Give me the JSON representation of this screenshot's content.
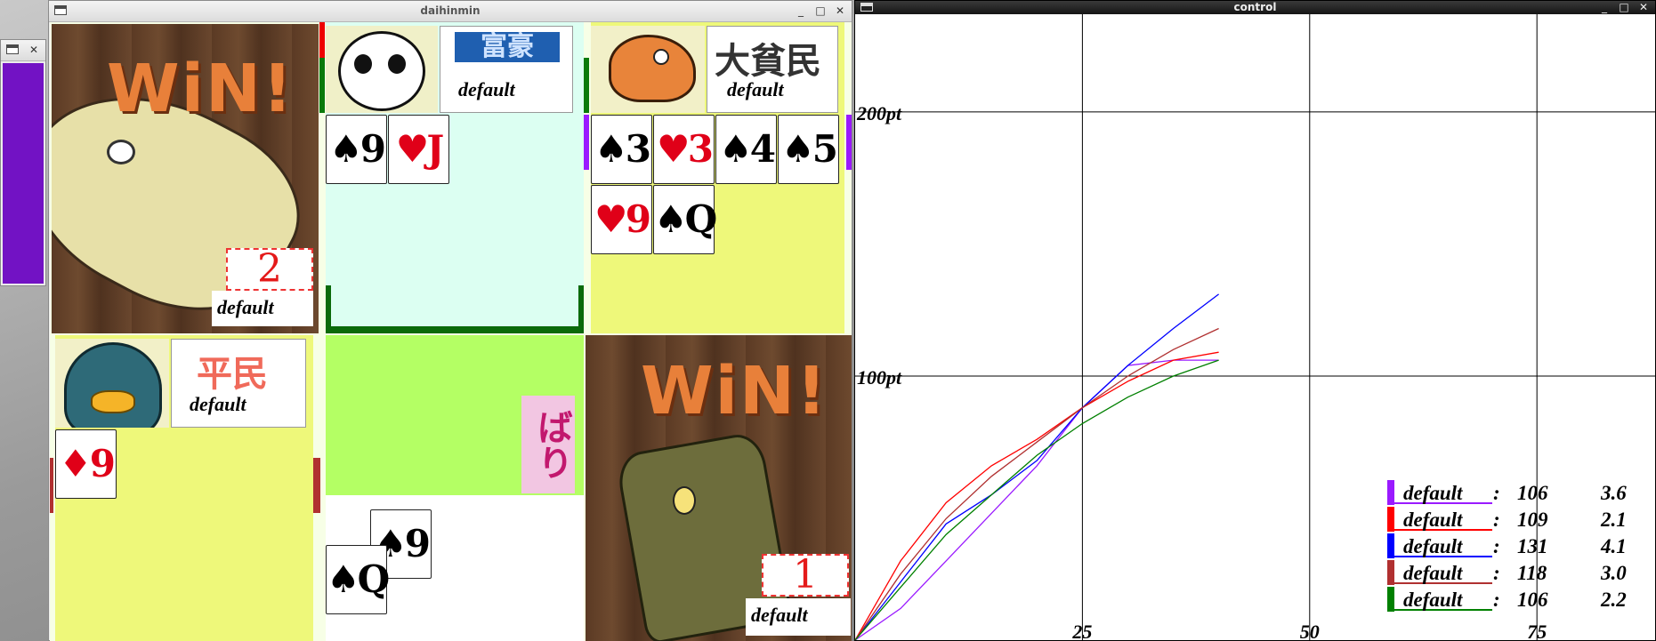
{
  "small_window": {
    "close": "✕"
  },
  "game_window": {
    "title": "daihinmin",
    "buttons": {
      "minimize": "_",
      "maximize": "□",
      "close": "✕"
    },
    "top_left": {
      "win_text": "WiN!",
      "rank_number": "2",
      "player_name": "default"
    },
    "top_middle": {
      "rank_label": "富豪",
      "player_name": "default",
      "cards": [
        {
          "suit": "♠",
          "rank": "9",
          "color": "black"
        },
        {
          "suit": "♥",
          "rank": "J",
          "color": "red"
        }
      ]
    },
    "top_right": {
      "rank_label": "大貧民",
      "player_name": "default",
      "cards": [
        {
          "suit": "♠",
          "rank": "3",
          "color": "black"
        },
        {
          "suit": "♥",
          "rank": "3",
          "color": "red"
        },
        {
          "suit": "♠",
          "rank": "4",
          "color": "black"
        },
        {
          "suit": "♠",
          "rank": "5",
          "color": "black"
        },
        {
          "suit": "♥",
          "rank": "9",
          "color": "red"
        },
        {
          "suit": "♠",
          "rank": "Q",
          "color": "black"
        }
      ]
    },
    "bottom_left": {
      "rank_label": "平民",
      "player_name": "default",
      "cards": [
        {
          "suit": "♦",
          "rank": "9",
          "color": "red"
        }
      ]
    },
    "center": {
      "status_stamp": "ばり",
      "played_cards": [
        {
          "suit": "♠",
          "rank": "9",
          "color": "black"
        },
        {
          "suit": "♠",
          "rank": "Q",
          "color": "black"
        }
      ]
    },
    "bottom_right": {
      "win_text": "WiN!",
      "rank_number": "1",
      "player_name": "default"
    }
  },
  "control_window": {
    "title": "control",
    "buttons": {
      "minimize": "_",
      "maximize": "□",
      "close": "✕"
    }
  },
  "chart_data": {
    "type": "line",
    "title": "",
    "xlabel": "",
    "ylabel": "",
    "x_ticks": [
      "25",
      "50",
      "75"
    ],
    "y_ticks": [
      "100pt",
      "200pt"
    ],
    "xlim": [
      0,
      88
    ],
    "ylim": [
      0,
      237
    ],
    "grid": true,
    "legend_position": "bottom-right",
    "series": [
      {
        "name": "default",
        "color": "#9a1aff",
        "score": "106",
        "avg": "3.6",
        "x": [
          0,
          5,
          10,
          15,
          20,
          25,
          30,
          35,
          40
        ],
        "y": [
          0,
          12,
          30,
          48,
          66,
          88,
          104,
          106,
          106
        ]
      },
      {
        "name": "default",
        "color": "#ff0000",
        "score": "109",
        "avg": "2.1",
        "x": [
          0,
          5,
          10,
          15,
          20,
          25,
          30,
          35,
          40
        ],
        "y": [
          0,
          30,
          52,
          66,
          76,
          88,
          98,
          106,
          109
        ]
      },
      {
        "name": "default",
        "color": "#0000ff",
        "score": "131",
        "avg": "4.1",
        "x": [
          0,
          5,
          10,
          15,
          20,
          25,
          30,
          35,
          40
        ],
        "y": [
          0,
          22,
          44,
          55,
          68,
          88,
          104,
          118,
          131
        ]
      },
      {
        "name": "default",
        "color": "#b03030",
        "score": "118",
        "avg": "3.0",
        "x": [
          0,
          5,
          10,
          15,
          20,
          25,
          30,
          35,
          40
        ],
        "y": [
          0,
          25,
          46,
          62,
          75,
          88,
          100,
          110,
          118
        ]
      },
      {
        "name": "default",
        "color": "#008000",
        "score": "106",
        "avg": "2.2",
        "x": [
          0,
          5,
          10,
          15,
          20,
          25,
          30,
          35,
          40
        ],
        "y": [
          0,
          20,
          40,
          55,
          70,
          82,
          92,
          100,
          106
        ]
      }
    ]
  }
}
